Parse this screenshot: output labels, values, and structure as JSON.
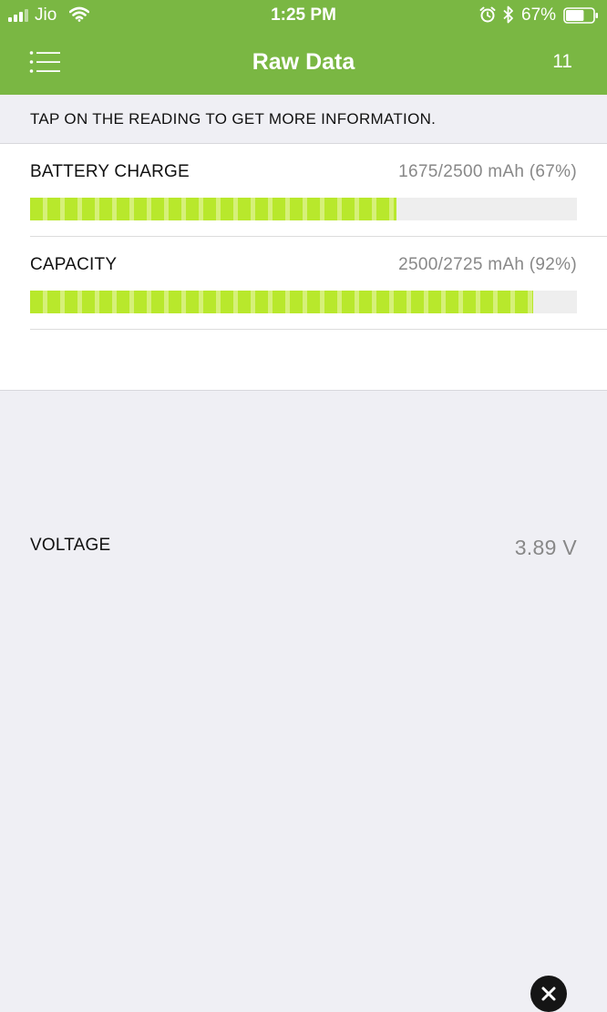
{
  "status_bar": {
    "carrier": "Jio",
    "time": "1:25 PM",
    "battery_percent": "67%",
    "battery_level": 0.67
  },
  "nav": {
    "title": "Raw Data",
    "count": "11"
  },
  "info": {
    "text": "TAP ON THE READING TO GET MORE INFORMATION."
  },
  "rows": [
    {
      "label": "BATTERY CHARGE",
      "value": "1675/2500 mAh (67%)",
      "fill": 0.67
    },
    {
      "label": "CAPACITY",
      "value": "2500/2725 mAh (92%)",
      "fill": 0.92
    },
    {
      "label": "VOLTAGE",
      "value": "3.89 V"
    }
  ],
  "colors": {
    "accent": "#7ab743",
    "bar_fill": "#b8e82c",
    "bar_stripe": "#d6f079",
    "bar_track": "#eeeeee",
    "background": "#efeff4"
  }
}
